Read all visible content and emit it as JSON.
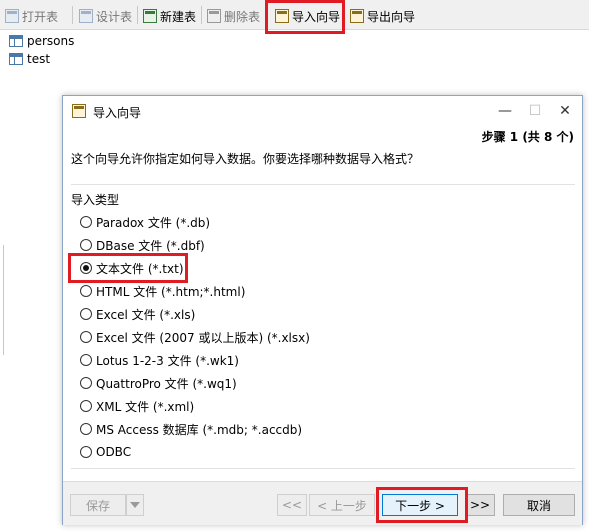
{
  "toolbar": {
    "open_table": "打开表",
    "design_table": "设计表",
    "new_table": "新建表",
    "delete_table": "删除表",
    "import_wizard": "导入向导",
    "export_wizard": "导出向导"
  },
  "tables": [
    "persons",
    "test"
  ],
  "dialog": {
    "title": "导入向导",
    "step": "步骤 1 (共 8 个)",
    "intro": "这个向导允许你指定如何导入数据。你要选择哪种数据导入格式？",
    "group_title": "导入类型",
    "options": [
      "Paradox 文件 (*.db)",
      "DBase 文件 (*.dbf)",
      "文本文件 (*.txt)",
      "HTML 文件 (*.htm;*.html)",
      "Excel 文件 (*.xls)",
      "Excel 文件 (2007 或以上版本) (*.xlsx)",
      "Lotus 1-2-3 文件 (*.wk1)",
      "QuattroPro 文件 (*.wq1)",
      "XML 文件 (*.xml)",
      "MS Access 数据库 (*.mdb; *.accdb)",
      "ODBC"
    ],
    "selected_option": "文本文件 (*.txt)",
    "buttons": {
      "save": "保存",
      "first": "<<",
      "prev": "< 上一步",
      "next": "下一步 >",
      "last": ">>",
      "cancel": "取消"
    }
  },
  "colors": {
    "annotation": "#e01b24",
    "accent": "#0078d7"
  }
}
